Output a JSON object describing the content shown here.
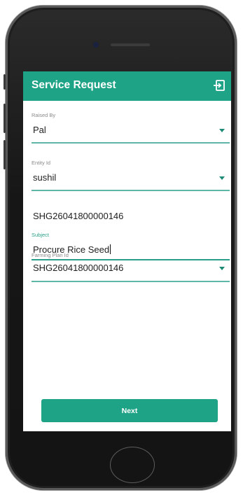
{
  "appbar": {
    "title": "Service Request",
    "action_icon": "logout-icon"
  },
  "form": {
    "raised_by": {
      "label": "Raised By",
      "value": "Pal"
    },
    "entity_id": {
      "label": "Entity Id",
      "value": "sushil"
    },
    "code_text": "SHG26041800000146",
    "subject": {
      "label": "Subject",
      "value": "Procure Rice Seed"
    },
    "farming_plan": {
      "label": "Farming Plan Id",
      "value": "SHG26041800000146"
    }
  },
  "actions": {
    "next_label": "Next"
  },
  "colors": {
    "primary": "#1fa386",
    "underline": "#2a9e89",
    "arrow": "#1c8a74"
  }
}
